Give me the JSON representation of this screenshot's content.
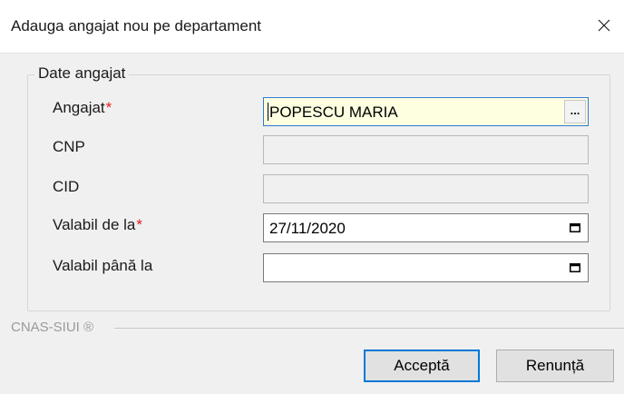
{
  "window": {
    "title": "Adauga angajat nou pe departament"
  },
  "group": {
    "legend": "Date angajat"
  },
  "fields": {
    "angajat": {
      "label": "Angajat",
      "required": "*",
      "value": "POPESCU MARIA",
      "browse": "..."
    },
    "cnp": {
      "label": "CNP",
      "value": ""
    },
    "cid": {
      "label": "CID",
      "value": ""
    },
    "valabil_de_la": {
      "label": "Valabil de la",
      "required": "*",
      "value": "27/11/2020"
    },
    "valabil_pana_la": {
      "label": "Valabil până la",
      "value": ""
    }
  },
  "footer": {
    "brand": "CNAS-SIUI ®",
    "accept_label": "Acceptă",
    "cancel_label": "Renunță"
  },
  "colors": {
    "accent": "#0078d7",
    "required": "#e02020",
    "highlight_field": "#fefee0"
  }
}
